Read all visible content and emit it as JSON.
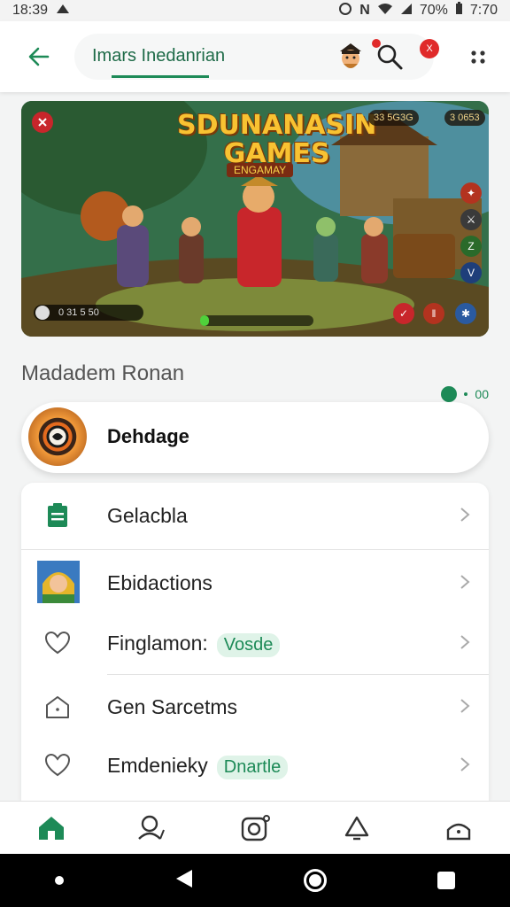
{
  "status_bar": {
    "time": "18:39",
    "battery": "70%",
    "clock_right": "7:70"
  },
  "app_bar": {
    "back_icon": "arrow-left-icon",
    "search_text": "Imars Inedanrian",
    "promo_badge": "X",
    "accent": "#1d8a57"
  },
  "hero": {
    "title_line1": "SDUNANASIN",
    "title_line2": "GAMES",
    "subtitle": "ENGAMAY",
    "stat_left": "33 5G3G",
    "stat_right": "3 0653",
    "player_text": "0 31 5 50",
    "progress": 0.08
  },
  "section": {
    "title": "Madadem Ronan",
    "meta_label": "00"
  },
  "featured": {
    "label": "Dehdage"
  },
  "list": {
    "items": [
      {
        "label": "Gelacbla",
        "icon": "clipboard-icon"
      },
      {
        "label": "Ebidactions",
        "icon": "avatar-icon"
      },
      {
        "label": "Finglamon:",
        "tag": "Vosde",
        "icon": "heart-icon"
      },
      {
        "label": "Gen Sarcetms",
        "icon": "house-icon"
      },
      {
        "label": "Emdenieky",
        "tag": "Dnartle",
        "icon": "heart-icon"
      }
    ]
  },
  "bottom_nav": [
    {
      "name": "home-icon"
    },
    {
      "name": "search-people-icon"
    },
    {
      "name": "camera-icon"
    },
    {
      "name": "notification-icon"
    },
    {
      "name": "profile-icon"
    }
  ]
}
